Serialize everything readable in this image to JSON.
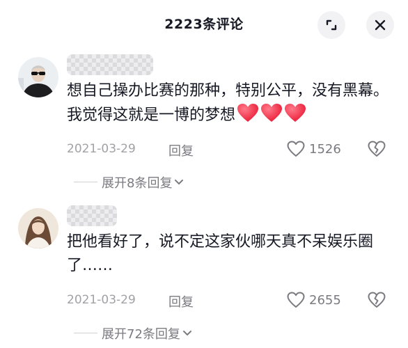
{
  "header": {
    "title": "2223条评论",
    "expand_icon": "fullscreen-icon",
    "close_icon": "close-icon"
  },
  "comments": [
    {
      "avatar": "avatar-man-sunglasses",
      "text": "想自己操办比赛的那种，特别公平，没有黑幕。我觉得这就是一博的梦想",
      "emoji": [
        "red-heart",
        "red-heart",
        "red-heart"
      ],
      "date": "2021-03-29",
      "reply_label": "回复",
      "likes": "1526",
      "expand_label": "展开8条回复"
    },
    {
      "avatar": "avatar-woman",
      "text": "把他看好了，说不定这家伙哪天真不呆娱乐圈了……",
      "emoji": [],
      "date": "2021-03-29",
      "reply_label": "回复",
      "likes": "2655",
      "expand_label": "展开72条回复"
    }
  ],
  "colors": {
    "primary_text": "#161823",
    "secondary_text": "#7a7a80",
    "date_text": "#a1a1a6",
    "heart": "#fe2c55"
  }
}
